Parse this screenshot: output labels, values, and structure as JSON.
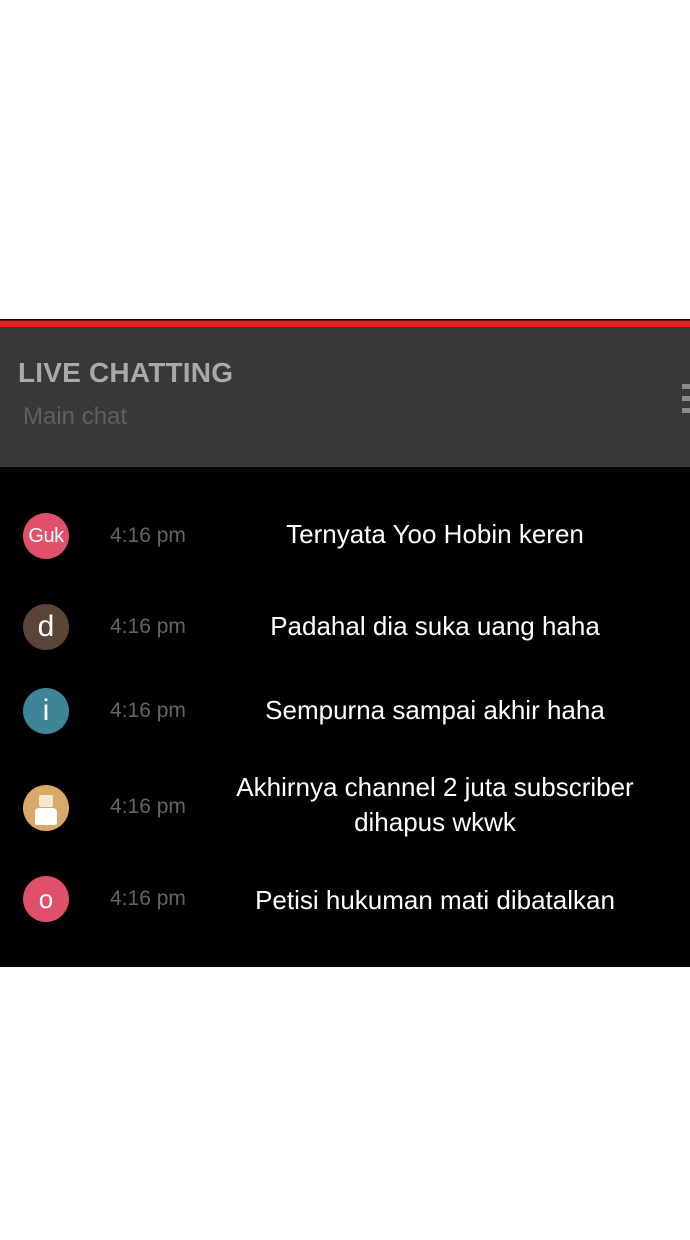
{
  "chat": {
    "title": "LIVE CHATTING",
    "subtitle": "Main chat",
    "menu_icon": "more-vertical-icon",
    "accent_color": "#e8201a",
    "messages": [
      {
        "avatar_text": "Guk",
        "avatar_color": "#e0506a",
        "time": "4:16 pm",
        "text": "Ternyata Yoo Hobin keren"
      },
      {
        "avatar_text": "d",
        "avatar_color": "#5a4438",
        "time": "4:16 pm",
        "text": "Padahal dia suka uang haha"
      },
      {
        "avatar_text": "i",
        "avatar_color": "#3f8597",
        "time": "4:16 pm",
        "text": "Sempurna sampai akhir haha"
      },
      {
        "avatar_icon": "person-icon",
        "avatar_color": "#d9a96a",
        "time": "4:16 pm",
        "text": "Akhirnya channel 2 juta subscriber dihapus wkwk"
      },
      {
        "avatar_text": "o",
        "avatar_color": "#e0506a",
        "time": "4:16 pm",
        "text": "Petisi hukuman mati dibatalkan"
      }
    ]
  }
}
